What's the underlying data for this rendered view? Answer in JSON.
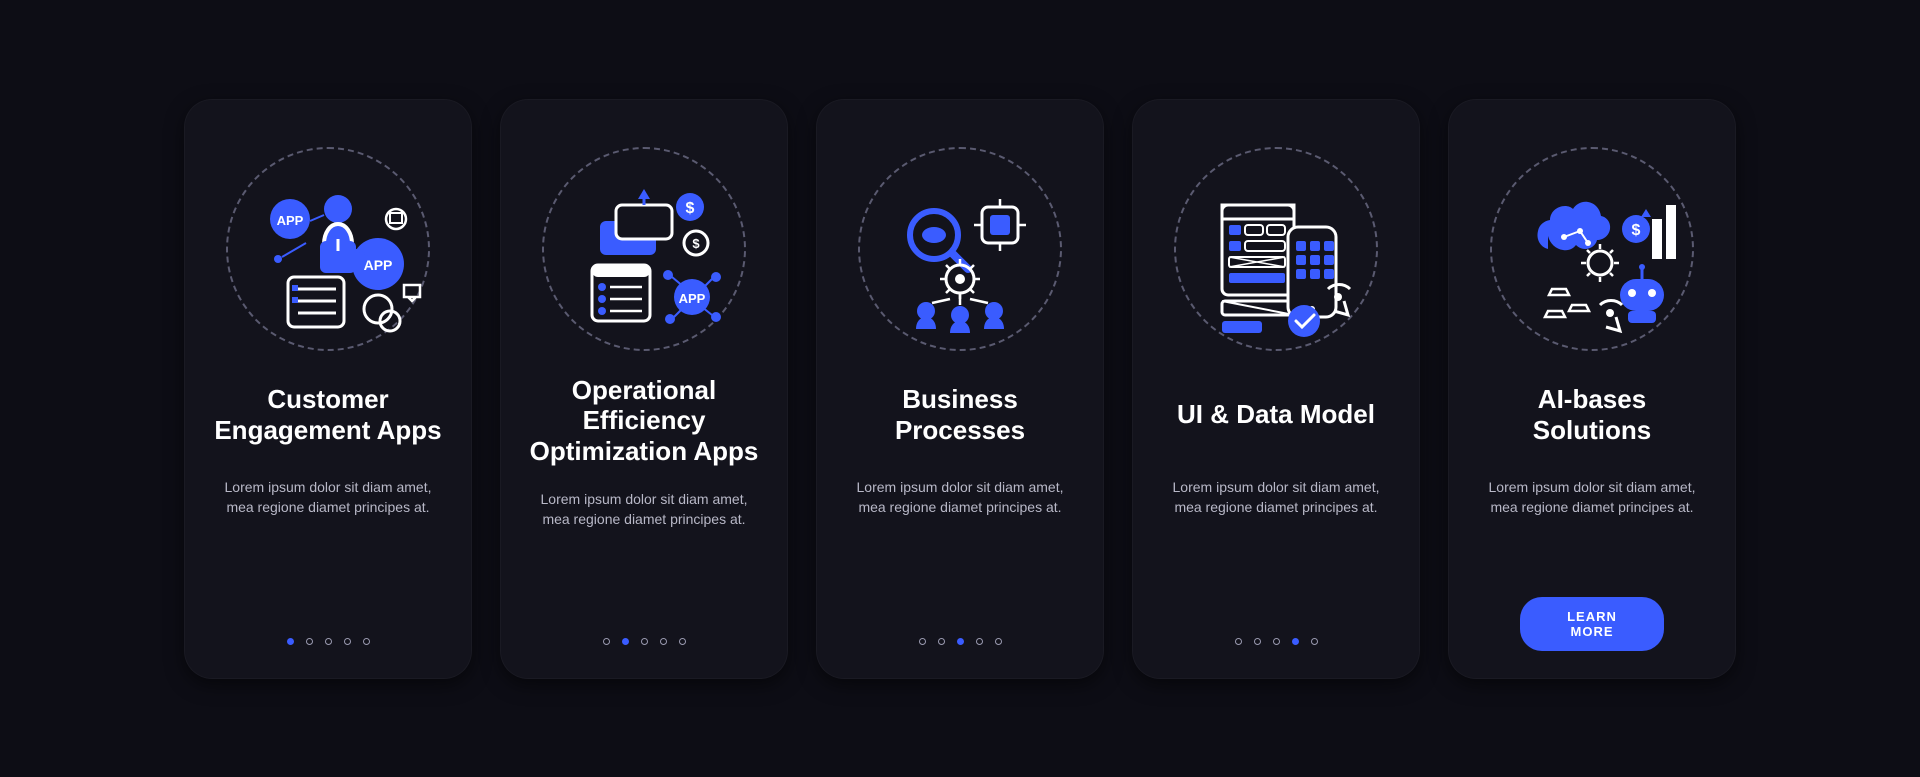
{
  "accent": "#3a5cff",
  "lorem": "Lorem ipsum dolor sit diam amet, mea regione diamet principes at.",
  "cards": [
    {
      "icon": "customer-engagement-icon",
      "title": "Customer Engagement Apps",
      "active_dot": 0,
      "has_button": false
    },
    {
      "icon": "operational-efficiency-icon",
      "title": "Operational Efficiency Optimization Apps",
      "active_dot": 1,
      "has_button": false
    },
    {
      "icon": "business-processes-icon",
      "title": "Business Processes",
      "active_dot": 2,
      "has_button": false
    },
    {
      "icon": "ui-data-model-icon",
      "title": "UI & Data Model",
      "active_dot": 3,
      "has_button": false
    },
    {
      "icon": "ai-solutions-icon",
      "title": "AI-bases Solutions",
      "active_dot": 4,
      "has_button": true
    }
  ],
  "button_label": "LEARN MORE",
  "dot_count": 5
}
